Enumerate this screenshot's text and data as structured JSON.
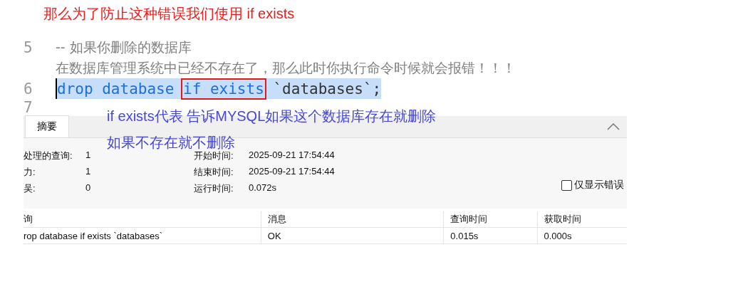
{
  "title": "那么为了防止这种错误我们使用 if exists",
  "editor": {
    "lines": [
      {
        "number": "5",
        "selected": false,
        "segments": [
          {
            "kind": "comment",
            "text": "-- 如果你删除的数据库",
            "boxed": false
          }
        ]
      },
      {
        "selected": false,
        "segments": [
          {
            "kind": "comment",
            "text": "在数据库管理系统中已经不存在了，那么此时你执行命令时候就会报错！！！",
            "boxed": false
          }
        ]
      },
      {
        "number": "6",
        "selected": true,
        "segments": [
          {
            "kind": "keyword",
            "text": "drop database ",
            "boxed": false
          },
          {
            "kind": "keyword",
            "text": "if exists",
            "boxed": true
          },
          {
            "kind": "plain",
            "text": " `databases`;",
            "boxed": false
          }
        ]
      },
      {
        "number": "7",
        "selected": false
      }
    ]
  },
  "notes": [
    "if exists代表 告诉MYSQL如果这个数据库存在就删除",
    "如果不存在就不删除"
  ],
  "panel": {
    "tabs": [
      {
        "label": "摘要",
        "selected": true
      }
    ],
    "stats_left": [
      {
        "label": "处理的查询:",
        "value": "1"
      },
      {
        "label": "力:",
        "value": "1"
      },
      {
        "label": "吴:",
        "value": "0"
      }
    ],
    "stats_right": [
      {
        "label": "开始时间:",
        "value": "2025-09-21 17:54:44"
      },
      {
        "label": "结束时间:",
        "value": "2025-09-21 17:54:44"
      },
      {
        "label": "运行时间:",
        "value": "0.072s"
      }
    ],
    "errors_only": {
      "label": "仅显示错误",
      "checked": false
    },
    "table": {
      "columns": [
        "询",
        "消息",
        "查询时间",
        "获取时间"
      ],
      "rows": [
        [
          "rop database if exists `databases`",
          "OK",
          "0.015s",
          "0.000s"
        ]
      ]
    }
  }
}
